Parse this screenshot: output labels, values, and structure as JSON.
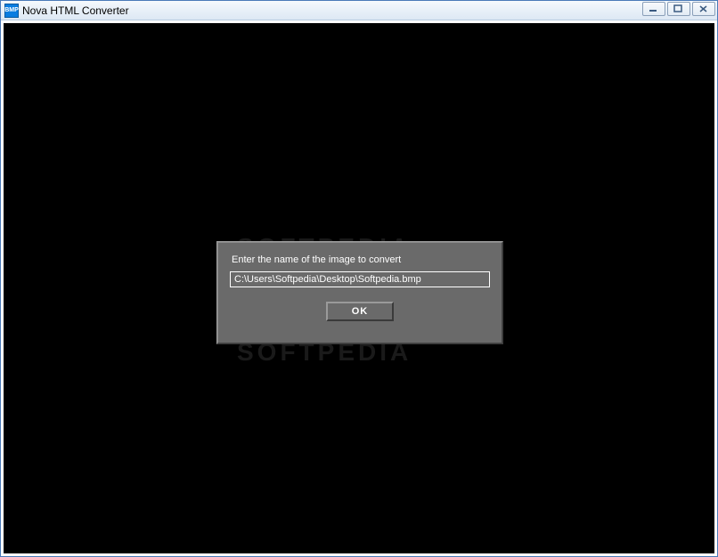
{
  "window": {
    "title": "Nova HTML Converter",
    "app_icon_label": "BMP"
  },
  "dialog": {
    "prompt": "Enter the name of the image to convert",
    "input_value": "C:\\Users\\Softpedia\\Desktop\\Softpedia.bmp",
    "ok_label": "OK"
  },
  "watermark": {
    "text": "SOFTPEDIA"
  }
}
